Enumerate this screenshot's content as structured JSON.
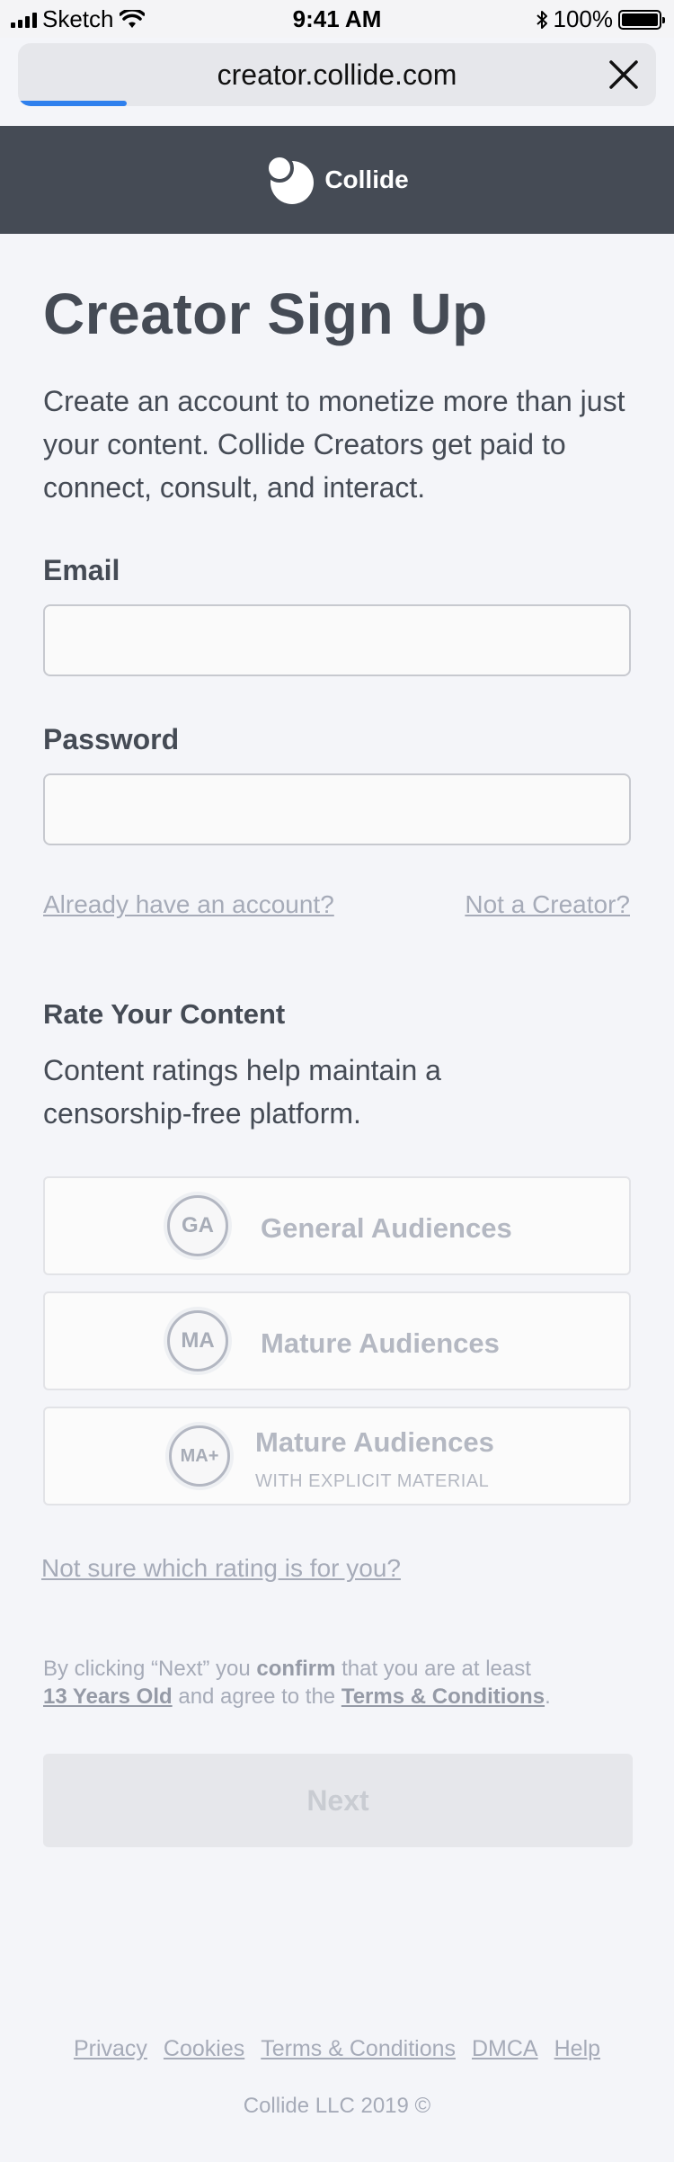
{
  "status_bar": {
    "carrier": "Sketch",
    "time": "9:41 AM",
    "battery": "100%"
  },
  "browser": {
    "url": "creator.collide.com",
    "load_progress": 0.17
  },
  "header": {
    "logo_text": "Collide"
  },
  "page": {
    "title": "Creator Sign Up",
    "intro": "Create an account to monetize more than just your content. Collide Creators get paid to connect, consult, and interact."
  },
  "form": {
    "email_label": "Email",
    "email_value": "",
    "password_label": "Password",
    "password_value": "",
    "login_link": "Already have an account?",
    "not_creator_link": "Not a Creator?"
  },
  "ratings": {
    "title": "Rate Your Content",
    "description": "Content ratings help maintain a censorship-free platform.",
    "options": [
      {
        "badge": "GA",
        "label": "General Audiences",
        "sublabel": ""
      },
      {
        "badge": "MA",
        "label": "Mature Audiences",
        "sublabel": ""
      },
      {
        "badge": "MA+",
        "label": "Mature Audiences",
        "sublabel": "WITH EXPLICIT MATERIAL"
      }
    ],
    "help_link": "Not sure which rating is for you?"
  },
  "legal": {
    "part1": "By clicking “Next” you ",
    "bold1": "confirm",
    "part2": " that you are at least",
    "age_link": "13 Years Old",
    "part3": " and agree to the ",
    "terms_link": "Terms & Conditions",
    "part4": "."
  },
  "next_button": "Next",
  "footer": {
    "links": [
      "Privacy",
      "Cookies",
      "Terms & Conditions",
      "DMCA",
      "Help"
    ],
    "copyright": "Collide LLC 2019 ©"
  },
  "colors": {
    "header_bg": "#454b55",
    "page_bg": "#f4f5f9",
    "text": "#454b55",
    "muted": "#a6abb8",
    "progress": "#2f80ed"
  }
}
